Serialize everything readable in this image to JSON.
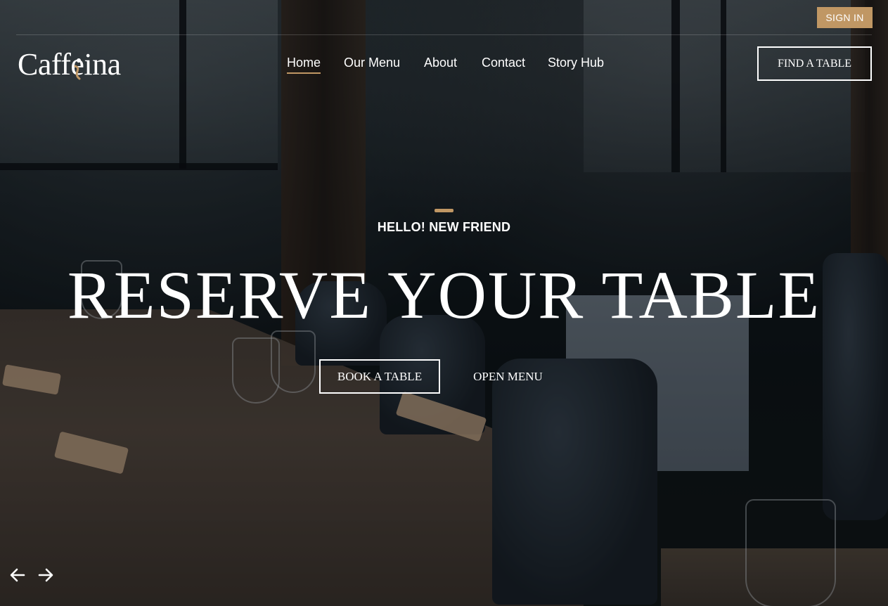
{
  "header": {
    "signin_label": "SIGN IN",
    "logo_text": "Caffeina",
    "nav": [
      {
        "label": "Home",
        "active": true
      },
      {
        "label": "Our Menu",
        "active": false
      },
      {
        "label": "About",
        "active": false
      },
      {
        "label": "Contact",
        "active": false
      },
      {
        "label": "Story Hub",
        "active": false
      }
    ],
    "cta_label": "FIND A TABLE"
  },
  "hero": {
    "eyebrow": "HELLO! NEW FRIEND",
    "headline": "RESERVE YOUR TABLE",
    "primary_button": "BOOK A TABLE",
    "secondary_button": "OPEN MENU",
    "background_image": "restaurant dining room with set tables"
  },
  "slider": {
    "prev_icon": "arrow-left-icon",
    "next_icon": "arrow-right-icon"
  },
  "colors": {
    "accent": "#c09764",
    "text": "#ffffff",
    "overlay": "#0b0e10"
  }
}
